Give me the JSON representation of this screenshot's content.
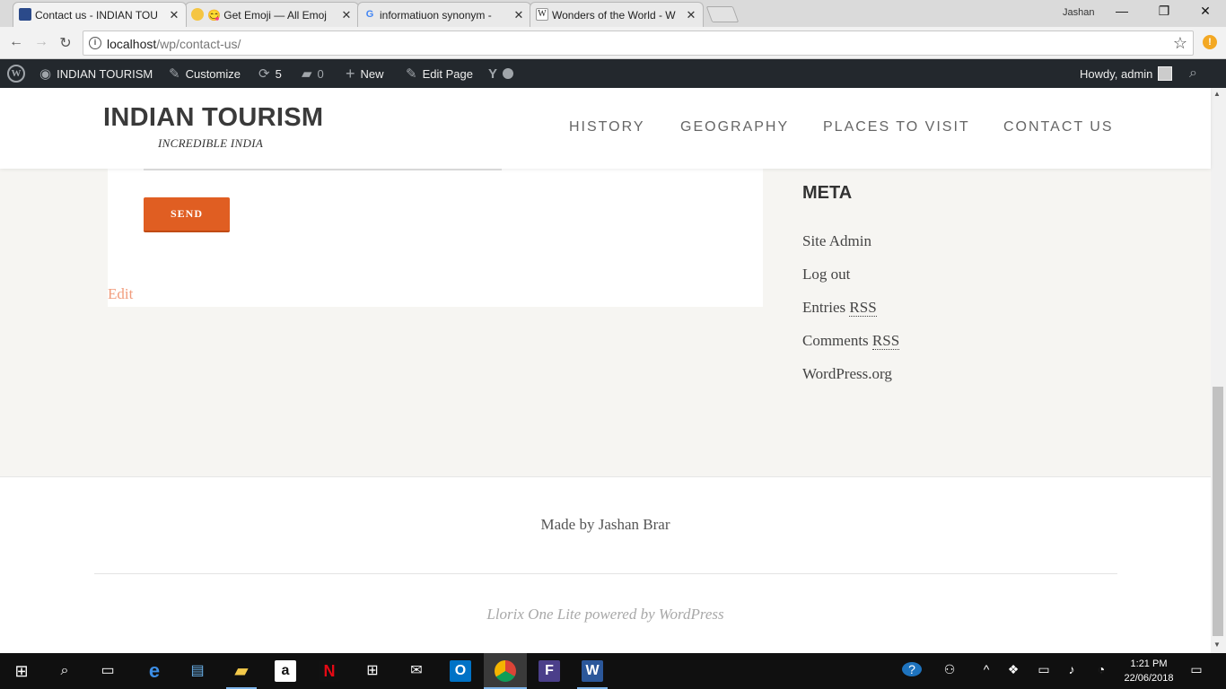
{
  "browser": {
    "tabs": [
      {
        "title": "Contact us - INDIAN TOU",
        "close": "✕"
      },
      {
        "title": "😋 Get Emoji — All Emoj",
        "close": "✕"
      },
      {
        "title": "informatiuon synonym - ",
        "close": "✕"
      },
      {
        "title": "Wonders of the World - W",
        "close": "✕"
      }
    ],
    "profile_name": "Jashan",
    "url_host": "localhost",
    "url_path": "/wp/contact-us/"
  },
  "adminbar": {
    "site_name": "INDIAN TOURISM",
    "customize": "Customize",
    "updates_count": "5",
    "comments_count": "0",
    "new": "New",
    "edit_page": "Edit Page",
    "howdy": "Howdy, admin"
  },
  "site": {
    "title": "INDIAN TOURISM",
    "tagline": "INCREDIBLE INDIA",
    "menu": [
      "HISTORY",
      "GEOGRAPHY",
      "PLACES TO VISIT",
      "CONTACT US"
    ]
  },
  "content": {
    "send_label": "SEND",
    "edit_label": "Edit"
  },
  "sidebar": {
    "title": "META",
    "links": [
      "Site Admin",
      "Log out",
      "Entries",
      "Comments",
      "WordPress.org"
    ],
    "rss_abbr": "RSS"
  },
  "footer": {
    "made_by": "Made by Jashan Brar",
    "powered": "Llorix One Lite powered by WordPress"
  },
  "taskbar": {
    "time": "1:21 PM",
    "date": "22/06/2018"
  },
  "colors": {
    "accent": "#e05e22",
    "adminbar": "#23282d",
    "page_bg": "#f6f5f2"
  }
}
